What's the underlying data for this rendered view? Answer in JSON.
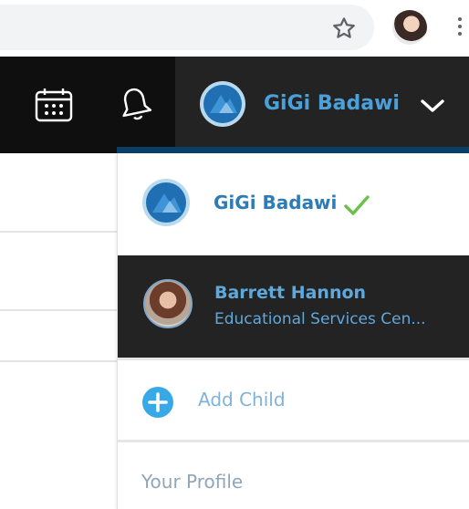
{
  "browser": {
    "star_icon": "star-outline-icon",
    "menu_icon": "kebab-menu-icon"
  },
  "header": {
    "account_name": "GiGi Badawi",
    "icons": [
      "calendar-icon",
      "bell-icon",
      "chevron-down-icon"
    ],
    "colors": {
      "bar": "#0f0f0f",
      "account_bg": "#232323",
      "accent": "#4aa0d9",
      "rule": "#0b3f66"
    }
  },
  "dropdown": {
    "current_account": {
      "name": "GiGi Badawi",
      "selected": true,
      "check_color": "#6cc04a"
    },
    "child_account": {
      "name": "Barrett Hannon",
      "organization": "Educational Services Cen..."
    },
    "add_child_label": "Add Child",
    "profile_label": "Your Profile"
  }
}
